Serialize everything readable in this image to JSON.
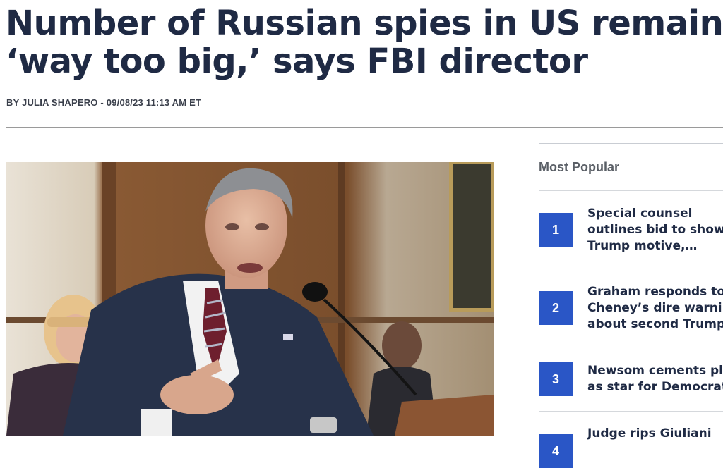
{
  "article": {
    "headline_lines": [
      "Number of Russian spies in US remains",
      "‘way too big,’ says FBI director"
    ],
    "byline": "BY JULIA SHAPERO - 09/08/23 11:13 AM ET"
  },
  "sidebar": {
    "title": "Most Popular",
    "items": [
      {
        "rank": "1",
        "lines": [
          "Special counsel",
          "outlines bid to show",
          "Trump motive,…"
        ]
      },
      {
        "rank": "2",
        "lines": [
          "Graham responds to",
          "Cheney’s dire warni",
          "about second Trump"
        ]
      },
      {
        "rank": "3",
        "lines": [
          "Newsom cements pl",
          "as star for Democrat"
        ]
      },
      {
        "rank": "4",
        "lines": [
          "Judge rips Giuliani"
        ]
      }
    ]
  },
  "colors": {
    "headline": "#1f2a44",
    "rank_badge": "#2a56c6",
    "byline": "#3a3f4b"
  }
}
